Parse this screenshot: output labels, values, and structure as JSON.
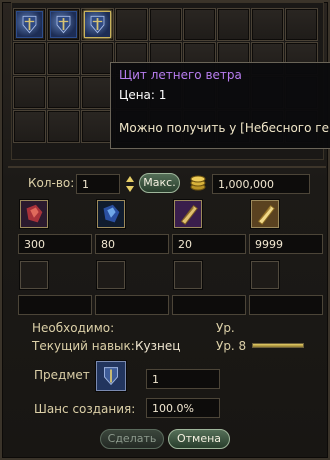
{
  "tooltip": {
    "name": "Щит летнего ветра",
    "price": "Цена: 1",
    "source": "Можно получить у [Небесного генерал"
  },
  "inventory": {
    "rows": 4,
    "cols": 9,
    "items": [
      {
        "icon": "shield-item-icon"
      },
      {
        "icon": "shield-item-icon"
      },
      {
        "icon": "shield-item-icon",
        "selected": true
      }
    ]
  },
  "quantity": {
    "label": "Кол-во:",
    "value": "1",
    "max_button": "Макс.",
    "price": "1,000,000",
    "coin_icon": "coin-stack-icon"
  },
  "materials": [
    {
      "icon": "red-crystal-icon",
      "count": "300"
    },
    {
      "icon": "blue-crystal-icon",
      "count": "80"
    },
    {
      "icon": "scroll-purple-icon",
      "count": "20"
    },
    {
      "icon": "scroll-gold-icon",
      "count": "9999"
    }
  ],
  "empty_slots": 4,
  "requirements": {
    "required_label": "Необходимо:",
    "level_label": "Ур.",
    "skill_label": "Текущий навык:",
    "skill_value": "Кузнец",
    "skill_level": "Ур. 8",
    "skill_progress": 1.0
  },
  "item_row": {
    "label": "Предмет",
    "quantity": "1"
  },
  "chance": {
    "label": "Шанс создания:",
    "value": "100.0%"
  },
  "buttons": {
    "make": "Сделать",
    "cancel": "Отмена"
  },
  "colors": {
    "rare_item_name": "#b87df0",
    "button_green": "#556f58",
    "accent_gold": "#e7cf68"
  }
}
